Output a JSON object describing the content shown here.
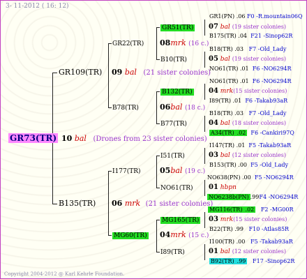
{
  "header": {
    "date": "3- 11-2012 ( 16: 12)"
  },
  "footer": {
    "copyright": "Copyright 2004-2012 @ Karl Kehrle Foundation."
  },
  "colors": {
    "border": "#c040c0",
    "queen_hl": "#ff88ff",
    "green_hl": "#22dd22",
    "cyan_hl": "#22dddd",
    "red_text": "#cc0000",
    "purple_text": "#9933cc",
    "blue_text": "#0000cc"
  },
  "root": {
    "name": "GR73(TR)",
    "num": "10",
    "tag": "bal",
    "note": "(Drones from 23 sister colonies)"
  },
  "gen1": [
    {
      "name": "GR109(TR)",
      "num": "09",
      "tag": "bal",
      "note": "(21 sister colonies)"
    },
    {
      "name": "B135(TR)",
      "num": "06",
      "tag": "mrk",
      "note": "(21 sister colonies)"
    }
  ],
  "gen2": [
    {
      "name": "GR22(TR)",
      "num": "08",
      "tag": "mrk",
      "note": "(16 c.)"
    },
    {
      "name": "B78(TR)",
      "num": "06",
      "tag": "bal",
      "note": "(18 c.)"
    },
    {
      "name": "I177(TR)",
      "num": "05",
      "tag": "bal",
      "note": "(19 c.)"
    },
    {
      "name": "MG60(TR)",
      "num": "04",
      "tag": "mrk",
      "note": "(15 c.)"
    }
  ],
  "gen3": [
    {
      "name": "GR51(TR)",
      "num": "07",
      "tag": "bal",
      "note": "(19 sister colonies)"
    },
    {
      "name": "B10(TR)",
      "num": "05",
      "tag": "bal",
      "note": "(19 sister colonies)"
    },
    {
      "name": "B132(TR)",
      "num": "04",
      "tag": "mrk",
      "note": "(15 sister colonies)"
    },
    {
      "name": "B77(TR)",
      "num": "04",
      "tag": "bal",
      "note": "(18 sister colonies)"
    },
    {
      "name": "I51(TR)",
      "num": "03",
      "tag": "bal",
      "note": "(12 sister colonies)"
    },
    {
      "name": "NO61(TR)",
      "num": "01",
      "tag": "hbpn",
      "note": ""
    },
    {
      "name": "MG165(TR)",
      "num": "03",
      "tag": "mrk",
      "note": "(15 sister colonies)"
    },
    {
      "name": "I89(TR)",
      "num": "01",
      "tag": "bal",
      "note": "(12 sister colonies)"
    }
  ],
  "gen4": [
    {
      "name": "GR1(PN)",
      "val": ".06",
      "id": "F0 -R.mountain06Q"
    },
    {
      "name": "B175(TR)",
      "val": ".04",
      "id": "F21 -Sinop62R"
    },
    {
      "name": "B18(TR)",
      "val": ".03",
      "id": "F7 -Old_Lady"
    },
    {
      "name": "NO61(TR)",
      "val": ".01",
      "id": "F6 -NO6294R"
    },
    {
      "name": "NO61(TR)",
      "val": ".01",
      "id": "F6 -NO6294R"
    },
    {
      "name": "I89(TR)",
      "val": ".01",
      "id": "F6 -Takab93aR"
    },
    {
      "name": "B18(TR)",
      "val": ".03",
      "id": "F7 -Old_Lady"
    },
    {
      "name": "A34(TR)",
      "val": ".02",
      "id": "F6 -Cankiri97Q"
    },
    {
      "name": "I147(TR)",
      "val": ".01",
      "id": "F5 -Takab93aR"
    },
    {
      "name": "B153(TR)",
      "val": ".00",
      "id": "F5 -Old_Lady"
    },
    {
      "name": "NO638(PN)",
      "val": ".00",
      "id": "F5 -NO6294R"
    },
    {
      "name": "NO6238b(PN)",
      "val": ".99",
      "id": "F4 -NO6294R"
    },
    {
      "name": "MG116(TR)",
      "val": ".02",
      "id": "F2 -MG00R"
    },
    {
      "name": "B22(TR)",
      "val": ".99",
      "id": "F10 -Atlas85R"
    },
    {
      "name": "I100(TR)",
      "val": ".00",
      "id": "F5 -Takab93aR"
    },
    {
      "name": "B92(TR)",
      "val": ".99",
      "id": "F17 -Sinop62R"
    }
  ]
}
